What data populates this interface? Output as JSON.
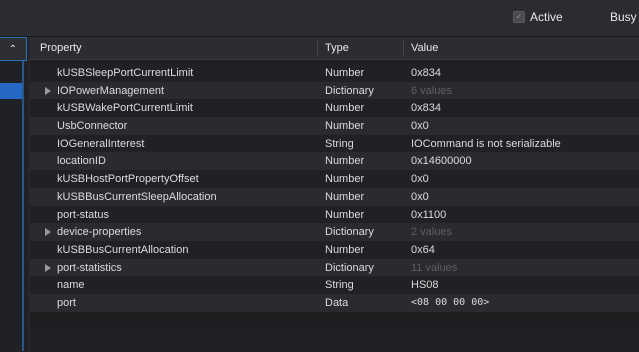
{
  "toolbar": {
    "active_label": "Active",
    "busy_label": "Busy",
    "active_checked": true
  },
  "columns": {
    "property": "Property",
    "type": "Type",
    "value": "Value"
  },
  "rows": [
    {
      "property": "kUSBSleepPortCurrentLimit",
      "type": "Number",
      "value": "0x834",
      "expandable": false,
      "muted": false
    },
    {
      "property": "IOPowerManagement",
      "type": "Dictionary",
      "value": "6 values",
      "expandable": true,
      "muted": true
    },
    {
      "property": "kUSBWakePortCurrentLimit",
      "type": "Number",
      "value": "0x834",
      "expandable": false,
      "muted": false
    },
    {
      "property": "UsbConnector",
      "type": "Number",
      "value": "0x0",
      "expandable": false,
      "muted": false
    },
    {
      "property": "IOGeneralInterest",
      "type": "String",
      "value": "IOCommand is not serializable",
      "expandable": false,
      "muted": false
    },
    {
      "property": "locationID",
      "type": "Number",
      "value": "0x14600000",
      "expandable": false,
      "muted": false
    },
    {
      "property": "kUSBHostPortPropertyOffset",
      "type": "Number",
      "value": "0x0",
      "expandable": false,
      "muted": false
    },
    {
      "property": "kUSBBusCurrentSleepAllocation",
      "type": "Number",
      "value": "0x0",
      "expandable": false,
      "muted": false
    },
    {
      "property": "port-status",
      "type": "Number",
      "value": "0x1100",
      "expandable": false,
      "muted": false
    },
    {
      "property": "device-properties",
      "type": "Dictionary",
      "value": "2 values",
      "expandable": true,
      "muted": true
    },
    {
      "property": "kUSBBusCurrentAllocation",
      "type": "Number",
      "value": "0x64",
      "expandable": false,
      "muted": false
    },
    {
      "property": "port-statistics",
      "type": "Dictionary",
      "value": "11 values",
      "expandable": true,
      "muted": true
    },
    {
      "property": "name",
      "type": "String",
      "value": "HS08",
      "expandable": false,
      "muted": false
    },
    {
      "property": "port",
      "type": "Data",
      "value": "<08 00 00 00>",
      "expandable": false,
      "muted": false
    }
  ]
}
